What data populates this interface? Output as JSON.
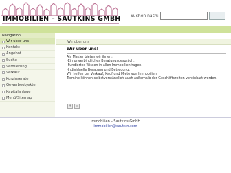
{
  "header": {
    "logo_text": "IMMOBILIEN – SAUTKINS GMBH",
    "search_label": "Suchen nach:",
    "search_value": "",
    "search_button": ""
  },
  "sidebar": {
    "title": "Navigation",
    "items": [
      {
        "label": "Wir uber uns",
        "active": true
      },
      {
        "label": "Kontakt"
      },
      {
        "label": "Angebot"
      },
      {
        "label": "Suche"
      },
      {
        "label": "Vermietung"
      },
      {
        "label": "Verkauf"
      },
      {
        "label": "Kurzinserate"
      },
      {
        "label": "Gewerbeobjekte"
      },
      {
        "label": "Kapitalanlage"
      },
      {
        "label": "Menü/Sitemap"
      }
    ]
  },
  "breadcrumb": "Wir uber uns",
  "content": {
    "title": "Wir uber uns!",
    "lines": [
      "Als Makler bieten wir ihnen:",
      "-Ein unverbindliches Beratungsgespräch.",
      "-Fundiertes Wissen in allen Immobilienfragen.",
      "-Individuelle Beratung und Betreuung.",
      "Wir helfen bei Verkauf, Kauf und Miete von Immobilien.",
      "Termine können selbstverständlich auch außerhalb der Geschäftszeiten vereinbart werden."
    ]
  },
  "footer": {
    "company": "Immobilien – Sautkins GmbH",
    "email": "immobilien@sautkin.com"
  },
  "colors": {
    "accent_green": "#cfe29a",
    "skyline": "#c07a9a"
  }
}
